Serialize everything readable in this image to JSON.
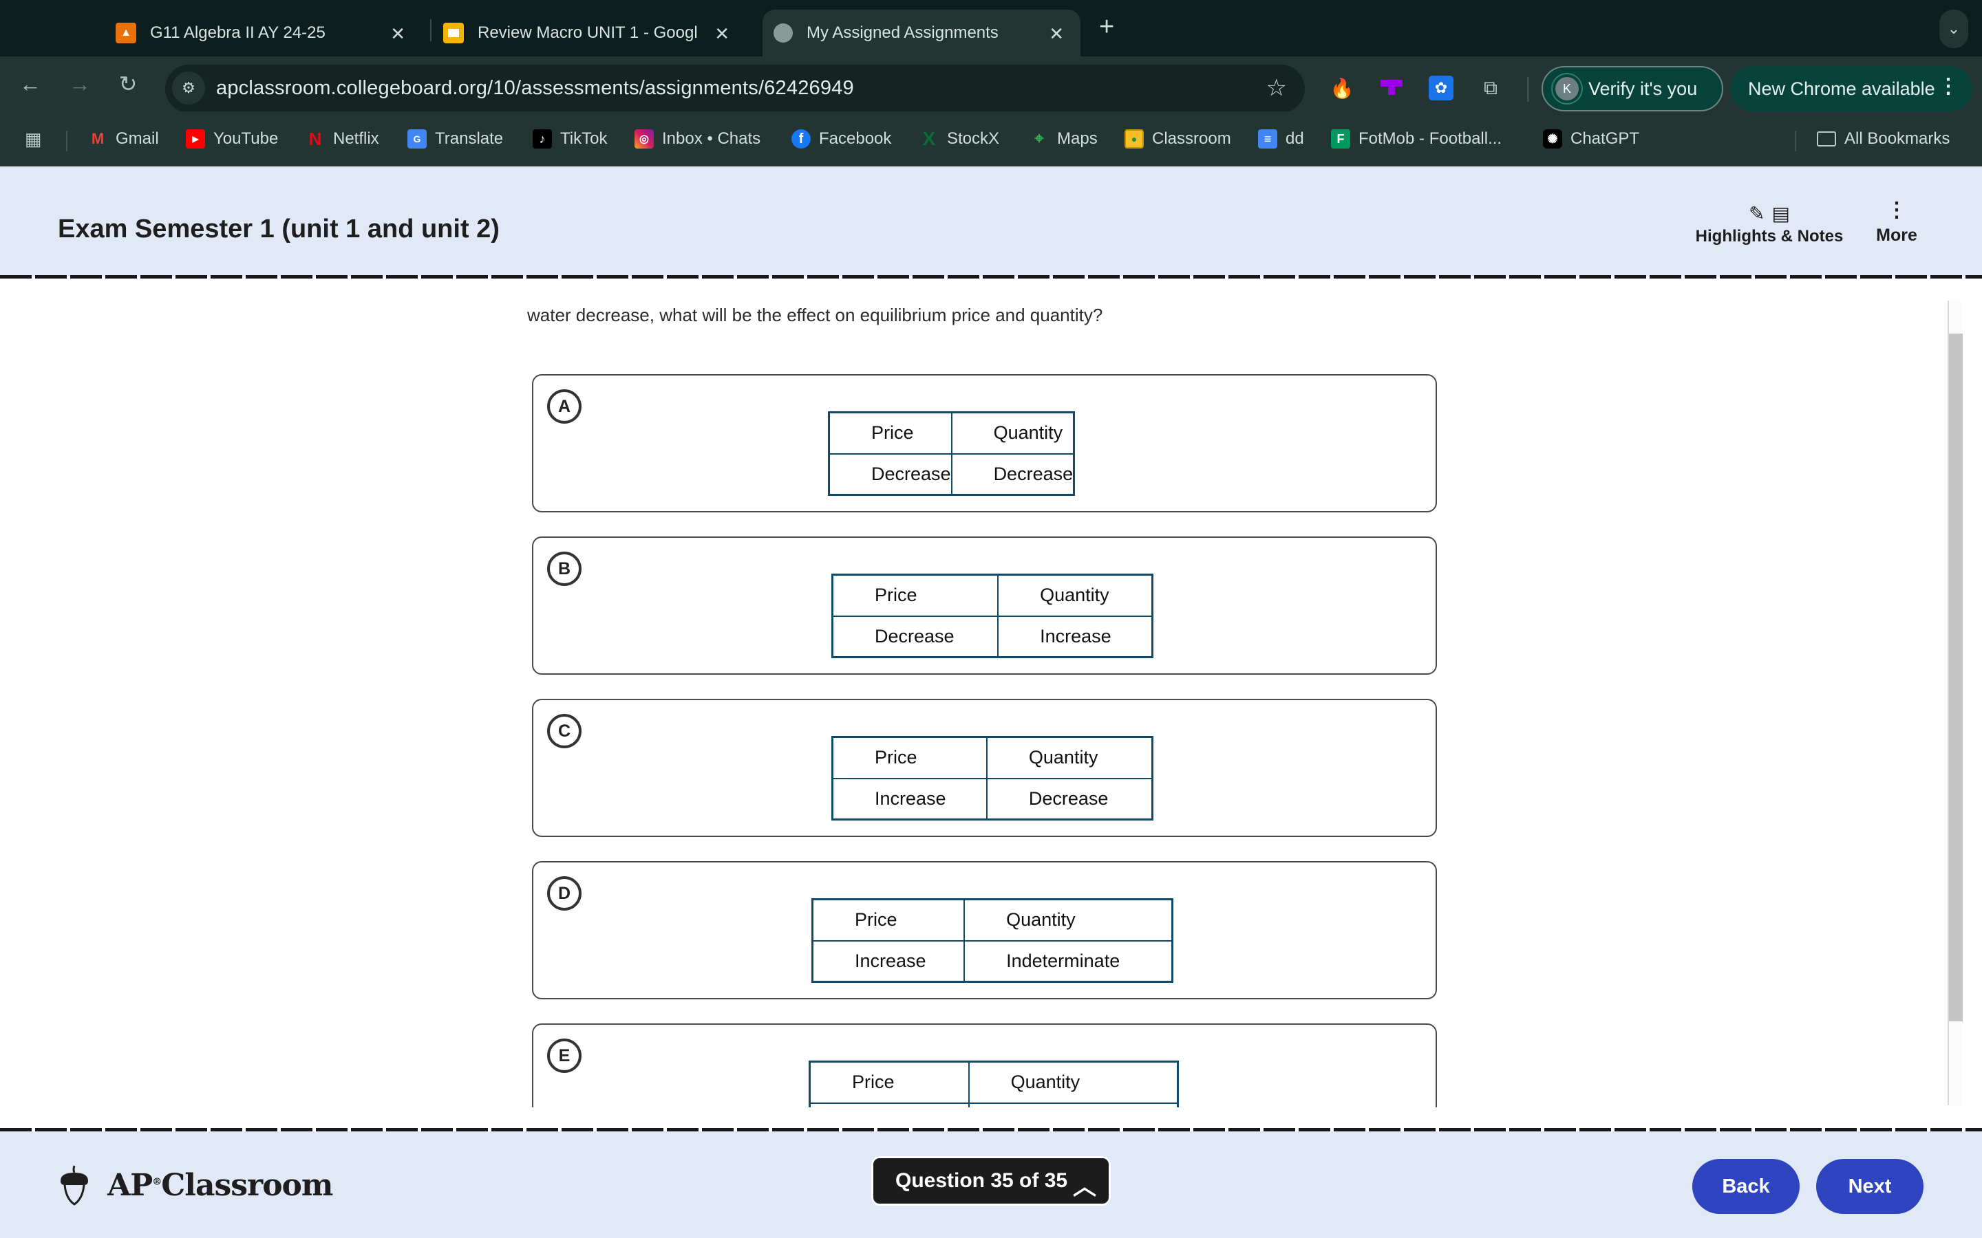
{
  "browser": {
    "tabs": [
      {
        "title": "G11 Algebra II AY 24-25",
        "icon": "google-classroom-icon",
        "active": false
      },
      {
        "title": "Review Macro UNIT 1 - Googl",
        "icon": "google-slides-icon",
        "active": false
      },
      {
        "title": "My Assigned Assignments",
        "icon": "globe-icon",
        "active": true
      }
    ],
    "new_tab": "+",
    "tab_search": "⌄",
    "url": "apclassroom.collegeboard.org/10/assessments/assignments/62426949",
    "profile_initial": "K",
    "verify_label": "Verify it's you",
    "update_label": "New Chrome available",
    "bookmarks": [
      {
        "label": "Gmail",
        "icon": "gmail-icon"
      },
      {
        "label": "YouTube",
        "icon": "youtube-icon"
      },
      {
        "label": "Netflix",
        "icon": "netflix-icon"
      },
      {
        "label": "Translate",
        "icon": "google-translate-icon"
      },
      {
        "label": "TikTok",
        "icon": "tiktok-icon"
      },
      {
        "label": "Inbox • Chats",
        "icon": "instagram-icon"
      },
      {
        "label": "Facebook",
        "icon": "facebook-icon"
      },
      {
        "label": "StockX",
        "icon": "stockx-icon"
      },
      {
        "label": "Maps",
        "icon": "google-maps-icon"
      },
      {
        "label": "Classroom",
        "icon": "google-classroom-icon"
      },
      {
        "label": "dd",
        "icon": "google-docs-icon"
      },
      {
        "label": "FotMob - Football...",
        "icon": "fotmob-icon"
      },
      {
        "label": "ChatGPT",
        "icon": "chatgpt-icon"
      }
    ],
    "all_bookmarks": "All Bookmarks"
  },
  "header": {
    "title": "Exam Semester 1 (unit 1 and unit 2)",
    "highlights_label": "Highlights & Notes",
    "more_label": "More"
  },
  "question": {
    "text_visible": "water decrease, what will be the effect on equilibrium price and quantity?",
    "options": [
      {
        "letter": "A",
        "headers": [
          "Price",
          "Quantity"
        ],
        "values": [
          "Decrease",
          "Decrease"
        ]
      },
      {
        "letter": "B",
        "headers": [
          "Price",
          "Quantity"
        ],
        "values": [
          "Decrease",
          "Increase"
        ]
      },
      {
        "letter": "C",
        "headers": [
          "Price",
          "Quantity"
        ],
        "values": [
          "Increase",
          "Decrease"
        ]
      },
      {
        "letter": "D",
        "headers": [
          "Price",
          "Quantity"
        ],
        "values": [
          "Increase",
          "Indeterminate"
        ]
      },
      {
        "letter": "E",
        "headers": [
          "Price",
          "Quantity"
        ],
        "values": [
          "",
          ""
        ]
      }
    ]
  },
  "footer": {
    "brand": "AP",
    "brand_mark": "®",
    "brand_suffix": "Classroom",
    "question_nav": "Question 35 of 35",
    "back_label": "Back",
    "next_label": "Next"
  },
  "colors": {
    "accent": "#2f45c0",
    "table_border": "#0e4b6a",
    "header_bg": "#e2e9f6"
  }
}
